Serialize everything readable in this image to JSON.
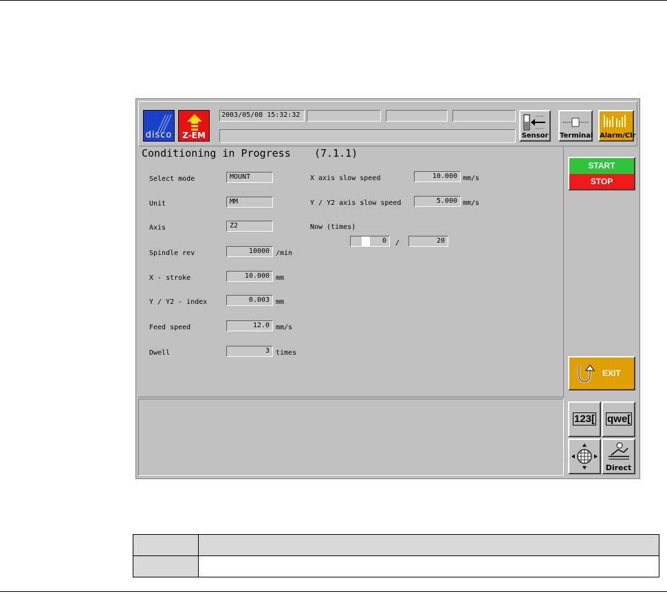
{
  "header": {
    "datetime": "2003/05/08 15:32:32",
    "logo_disco": "disco",
    "logo_zem": "Z-EM",
    "sensor_label": "Sensor",
    "terminal_label": "Terminal",
    "alarm_label": "Alarm/Clr"
  },
  "page": {
    "title": "Conditioning in Progress",
    "code": "(7.1.1)"
  },
  "left_params": [
    {
      "label": "Select mode",
      "value": "MOUNT",
      "unit": ""
    },
    {
      "label": "Unit",
      "value": "MM",
      "unit": ""
    },
    {
      "label": "Axis",
      "value": "Z2",
      "unit": ""
    },
    {
      "label": "Spindle rev",
      "value": "10000",
      "unit": "/min"
    },
    {
      "label": "X - stroke",
      "value": "10.000",
      "unit": "mm"
    },
    {
      "label": "Y / Y2 - index",
      "value": "0.003",
      "unit": "mm"
    },
    {
      "label": "Feed speed",
      "value": "12.0",
      "unit": "mm/s"
    },
    {
      "label": "Dwell",
      "value": "3",
      "unit": "times"
    }
  ],
  "right_params": [
    {
      "label": "X axis slow speed",
      "value": "10.000",
      "unit": "mm/s"
    },
    {
      "label": "Y / Y2 axis slow speed",
      "value": "5.000",
      "unit": "mm/s"
    }
  ],
  "now": {
    "label": "Now (times)",
    "current": "0",
    "separator": "/",
    "total": "20"
  },
  "side": {
    "start_label": "START",
    "stop_label": "STOP",
    "exit_label": "EXIT",
    "num_label": "123[",
    "alpha_label": "qwe[",
    "direct_label": "Direct"
  },
  "colors": {
    "start": "#2fc43a",
    "stop": "#f01818",
    "exit": "#e0a000",
    "panel": "#c0c0c0"
  }
}
